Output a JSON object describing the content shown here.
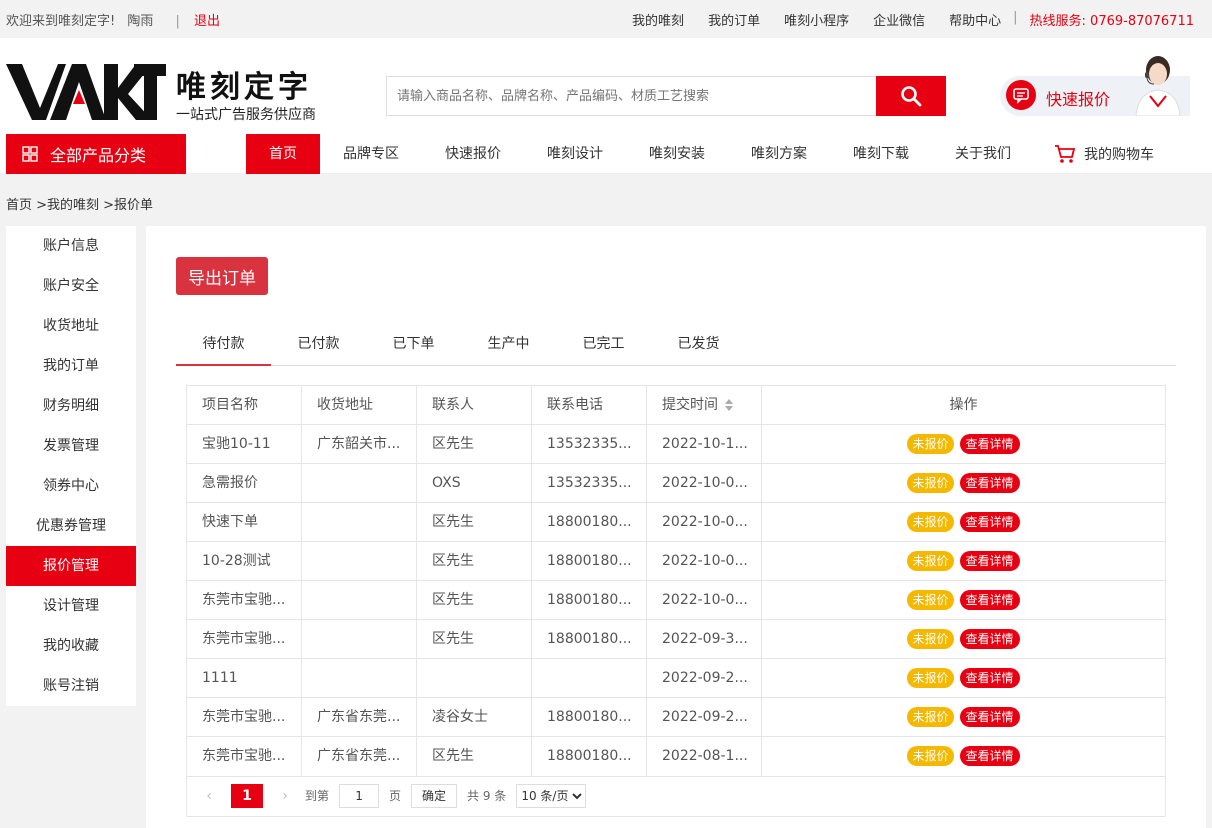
{
  "topbar": {
    "welcome": "欢迎来到唯刻定字!",
    "username": "陶雨",
    "logout": "退出",
    "links": [
      "我的唯刻",
      "我的订单",
      "唯刻小程序",
      "企业微信",
      "帮助中心"
    ],
    "hotline_label": "热线服务:",
    "hotline_number": "0769-87076711"
  },
  "header": {
    "logo_mark": "VAKT",
    "logo_cn": "唯刻定字",
    "logo_sub": "一站式广告服务供应商",
    "search_placeholder": "请输入商品名称、品牌名称、产品编码、材质工艺搜索",
    "quick_quote": "快速报价"
  },
  "nav": {
    "all_categories": "全部产品分类",
    "items": [
      "首页",
      "品牌专区",
      "快速报价",
      "唯刻设计",
      "唯刻安装",
      "唯刻方案",
      "唯刻下载",
      "关于我们"
    ],
    "cart": "我的购物车"
  },
  "breadcrumb": "首页 >我的唯刻 >报价单",
  "sidebar": [
    "账户信息",
    "账户安全",
    "收货地址",
    "我的订单",
    "财务明细",
    "发票管理",
    "领券中心",
    "优惠券管理",
    "报价管理",
    "设计管理",
    "我的收藏",
    "账号注销"
  ],
  "main": {
    "export": "导出订单",
    "tabs": [
      "待付款",
      "已付款",
      "已下单",
      "生产中",
      "已完工",
      "已发货"
    ],
    "headers": [
      "项目名称",
      "收货地址",
      "联系人",
      "联系电话",
      "提交时间",
      "操作"
    ],
    "rows": [
      [
        "宝驰10-11",
        "广东韶关市...",
        "区先生",
        "13532335...",
        "2022-10-1..."
      ],
      [
        "急需报价",
        "",
        "OXS",
        "13532335...",
        "2022-10-0..."
      ],
      [
        "快速下单",
        "",
        "区先生",
        "18800180...",
        "2022-10-0..."
      ],
      [
        "10-28测试",
        "",
        "区先生",
        "18800180...",
        "2022-10-0..."
      ],
      [
        "东莞市宝驰...",
        "",
        "区先生",
        "18800180...",
        "2022-10-0..."
      ],
      [
        "东莞市宝驰...",
        "",
        "区先生",
        "18800180...",
        "2022-09-3..."
      ],
      [
        "1111",
        "",
        "",
        "",
        "2022-09-2..."
      ],
      [
        "东莞市宝驰...",
        "广东省东莞...",
        "凌谷女士",
        "18800180...",
        "2022-09-2..."
      ],
      [
        "东莞市宝驰...",
        "广东省东莞...",
        "区先生",
        "18800180...",
        "2022-08-1..."
      ]
    ],
    "badge_status": "未报价",
    "badge_detail": "查看详情",
    "pager": {
      "current": "1",
      "goto_label": "到第",
      "goto_value": "1",
      "page_unit": "页",
      "confirm": "确定",
      "total": "共 9 条",
      "per_page": "10 条/页"
    }
  },
  "colors": {
    "brand_red": "#e60012",
    "badge_yellow": "#f5b800"
  }
}
